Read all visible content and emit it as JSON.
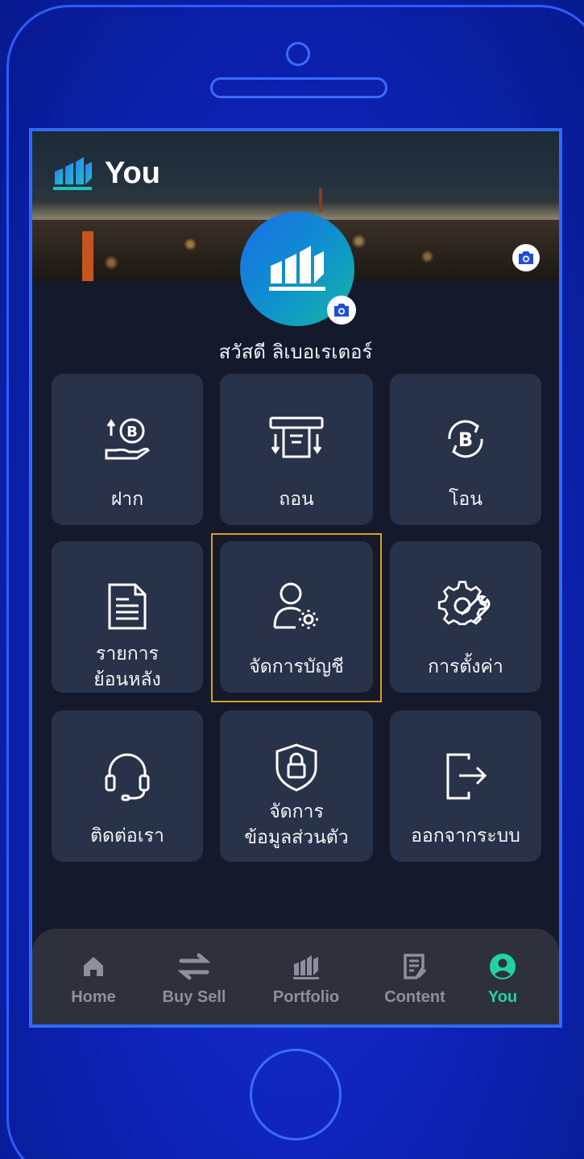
{
  "header": {
    "title": "You"
  },
  "profile": {
    "greeting": "สวัสดี ลิเบอเรเตอร์"
  },
  "menu": [
    {
      "label": "ฝาก",
      "icon": "deposit-icon"
    },
    {
      "label": "ถอน",
      "icon": "withdraw-icon"
    },
    {
      "label": "โอน",
      "icon": "transfer-icon"
    },
    {
      "label": "รายการ\nย้อนหลัง",
      "icon": "history-icon"
    },
    {
      "label": "จัดการบัญชี",
      "icon": "manage-account-icon"
    },
    {
      "label": "การตั้งค่า",
      "icon": "settings-icon"
    },
    {
      "label": "ติดต่อเรา",
      "icon": "headset-icon"
    },
    {
      "label": "จัดการ\nข้อมูลส่วนตัว",
      "icon": "privacy-shield-icon"
    },
    {
      "label": "ออกจากระบบ",
      "icon": "logout-icon"
    }
  ],
  "nav": [
    {
      "label": "Home",
      "icon": "home-icon"
    },
    {
      "label": "Buy Sell",
      "icon": "swap-icon"
    },
    {
      "label": "Portfolio",
      "icon": "portfolio-icon"
    },
    {
      "label": "Content",
      "icon": "content-icon"
    },
    {
      "label": "You",
      "icon": "profile-icon",
      "active": true
    }
  ],
  "colors": {
    "accent": "#22d3a0",
    "tile": "#283249",
    "selected_outline": "#d8a21c"
  }
}
